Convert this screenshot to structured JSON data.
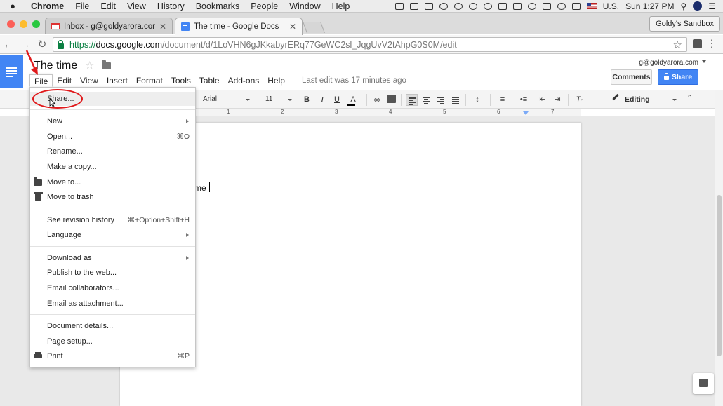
{
  "menubar": {
    "apple": "",
    "items": [
      "Chrome",
      "File",
      "Edit",
      "View",
      "History",
      "Bookmarks",
      "People",
      "Window",
      "Help"
    ],
    "locale": "U.S.",
    "clock": "Sun 1:27 PM"
  },
  "browser": {
    "tabs": [
      {
        "title": "Inbox - g@goldyarora.com - G",
        "icon": "gmail-icon"
      },
      {
        "title": "The time - Google Docs",
        "icon": "docs-icon"
      }
    ],
    "profile": "Goldy's Sandbox",
    "url": {
      "scheme": "https://",
      "host": "docs.google.com",
      "path": "/document/d/1LoVHN6gJKkabyrERq77GeWC2sl_JqgUvV2tAhpG0S0M/edit"
    }
  },
  "docs": {
    "title": "The time",
    "menus": [
      "File",
      "Edit",
      "View",
      "Insert",
      "Format",
      "Tools",
      "Table",
      "Add-ons",
      "Help"
    ],
    "last_edit": "Last edit was 17 minutes ago",
    "account_email": "g@goldyarora.com",
    "comments_label": "Comments",
    "share_label": "Share",
    "toolbar": {
      "font": "Arial",
      "size": "11",
      "bold": "B",
      "italic": "I",
      "underline": "U",
      "text_color": "A",
      "mode": "Editing"
    },
    "ruler_labels": [
      "1",
      "2",
      "3",
      "4",
      "5",
      "6",
      "7"
    ],
    "body_text": "me"
  },
  "file_menu": {
    "share": "Share...",
    "new": "New",
    "open": "Open...",
    "open_shortcut": "⌘O",
    "rename": "Rename...",
    "make_copy": "Make a copy...",
    "move_to": "Move to...",
    "move_to_trash": "Move to trash",
    "revision_history": "See revision history",
    "revision_shortcut": "⌘+Option+Shift+H",
    "language": "Language",
    "download_as": "Download as",
    "publish": "Publish to the web...",
    "email_collaborators": "Email collaborators...",
    "email_attachment": "Email as attachment...",
    "document_details": "Document details...",
    "page_setup": "Page setup...",
    "print": "Print",
    "print_shortcut": "⌘P"
  },
  "colors": {
    "accent": "#4285f4",
    "annotation": "#e0191b",
    "secure": "#0b8043"
  }
}
